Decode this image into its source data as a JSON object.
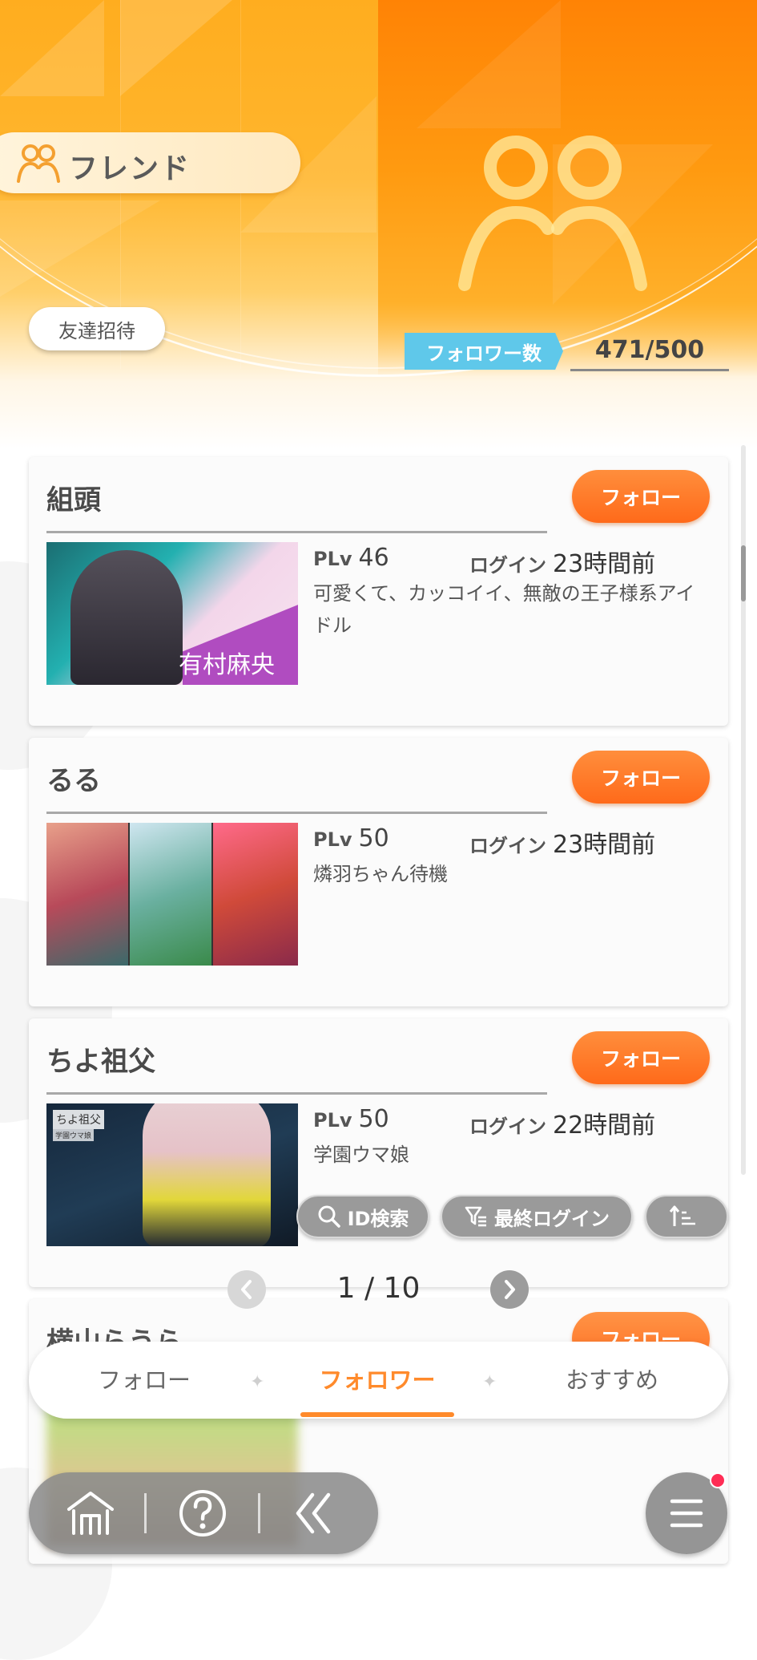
{
  "header": {
    "title": "フレンド",
    "invite_label": "友達招待",
    "follower_count_label": "フォロワー数",
    "follower_count_value": "471/500"
  },
  "friends": [
    {
      "name": "組頭",
      "follow_label": "フォロー",
      "plv_key": "PLv",
      "plv_value": "46",
      "login_key": "ログイン",
      "login_value": "23時間前",
      "comment": "可愛くて、カッコイイ、無敵の王子様系アイドル",
      "thumb_text": "有村麻央"
    },
    {
      "name": "るる",
      "follow_label": "フォロー",
      "plv_key": "PLv",
      "plv_value": "50",
      "login_key": "ログイン",
      "login_value": "23時間前",
      "comment": "燐羽ちゃん待機"
    },
    {
      "name": "ちよ祖父",
      "follow_label": "フォロー",
      "plv_key": "PLv",
      "plv_value": "50",
      "login_key": "ログイン",
      "login_value": "22時間前",
      "comment": "学園ウマ娘",
      "thumb_text": "ちよ祖父",
      "thumb_subtext": "学園ウマ娘"
    },
    {
      "name": "横山らうら",
      "follow_label": "フォロー"
    }
  ],
  "filters": {
    "id_search": "ID検索",
    "last_login": "最終ログイン",
    "sort_icon": "sort-ascending-icon"
  },
  "pagination": {
    "label": "1 / 10"
  },
  "tabs": [
    {
      "label": "フォロー",
      "active": false
    },
    {
      "label": "フォロワー",
      "active": true
    },
    {
      "label": "おすすめ",
      "active": false
    }
  ],
  "nav": {
    "icons": [
      "home-icon",
      "help-icon",
      "back-icon",
      "menu-icon"
    ],
    "notification": true
  },
  "colors": {
    "accent": "#ff8a2b",
    "header_orange": "#ff8305",
    "follow_button": "#ff6a1a",
    "count_label": "#5fc8ea",
    "notification": "#ff2d55"
  }
}
